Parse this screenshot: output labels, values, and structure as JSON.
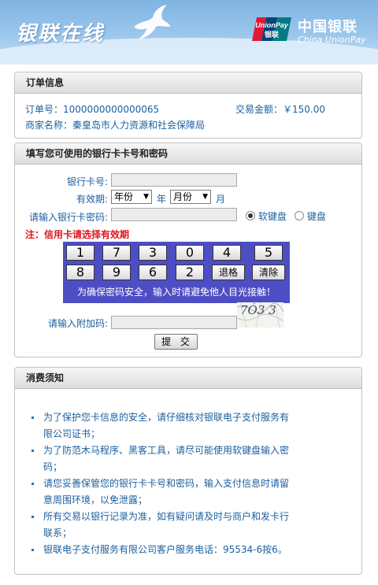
{
  "header": {
    "brand_title": "银联在线",
    "unionpay_logo_text_top": "UnionPay",
    "unionpay_logo_text_bottom": "银联",
    "unionpay_cn": "中国银联",
    "unionpay_en": "China UnionPay"
  },
  "order": {
    "title": "订单信息",
    "order_no_label": "订单号：",
    "order_no": "1000000000000065",
    "amount_label": "交易金额：",
    "amount": "￥150.00",
    "merchant_label": "商家名称：",
    "merchant": "秦皇岛市人力资源和社会保障局"
  },
  "card_form": {
    "title": "填写您可使用的银行卡卡号和密码",
    "card_no_label": "银行卡号:",
    "expiry_label": "有效期:",
    "year_select": "年份",
    "year_unit": "年",
    "month_select": "月份",
    "month_unit": "月",
    "pin_label": "请输入银行卡密码:",
    "soft_keyboard": "软键盘",
    "hard_keyboard": "键盘",
    "credit_note": "注：信用卡请选择有效期",
    "keypad_rows": [
      [
        "1",
        "7",
        "3",
        "0",
        "4",
        "5"
      ],
      [
        "8",
        "9",
        "6",
        "2",
        "退格",
        "清除"
      ]
    ],
    "keypad_note": "为确保密码安全，输入时请避免他人目光接触！",
    "captcha_label": "请输入附加码:",
    "captcha_text": "7Ó3 3",
    "submit_label": "提 交"
  },
  "notice": {
    "title": "消费须知",
    "items": [
      "为了保护您卡信息的安全，请仔细核对银联电子支付服务有限公司证书；",
      "为了防范木马程序、黑客工具，请尽可能使用软键盘输入密码；",
      "请您妥善保管您的银行卡卡号和密码，输入支付信息时请留意周围环境，以免泄露；",
      "所有交易以银行记录为准，如有疑问请及时与商户和发卡行联系；",
      "银联电子支付服务有限公司客户服务电话：95534-6按6。"
    ]
  }
}
